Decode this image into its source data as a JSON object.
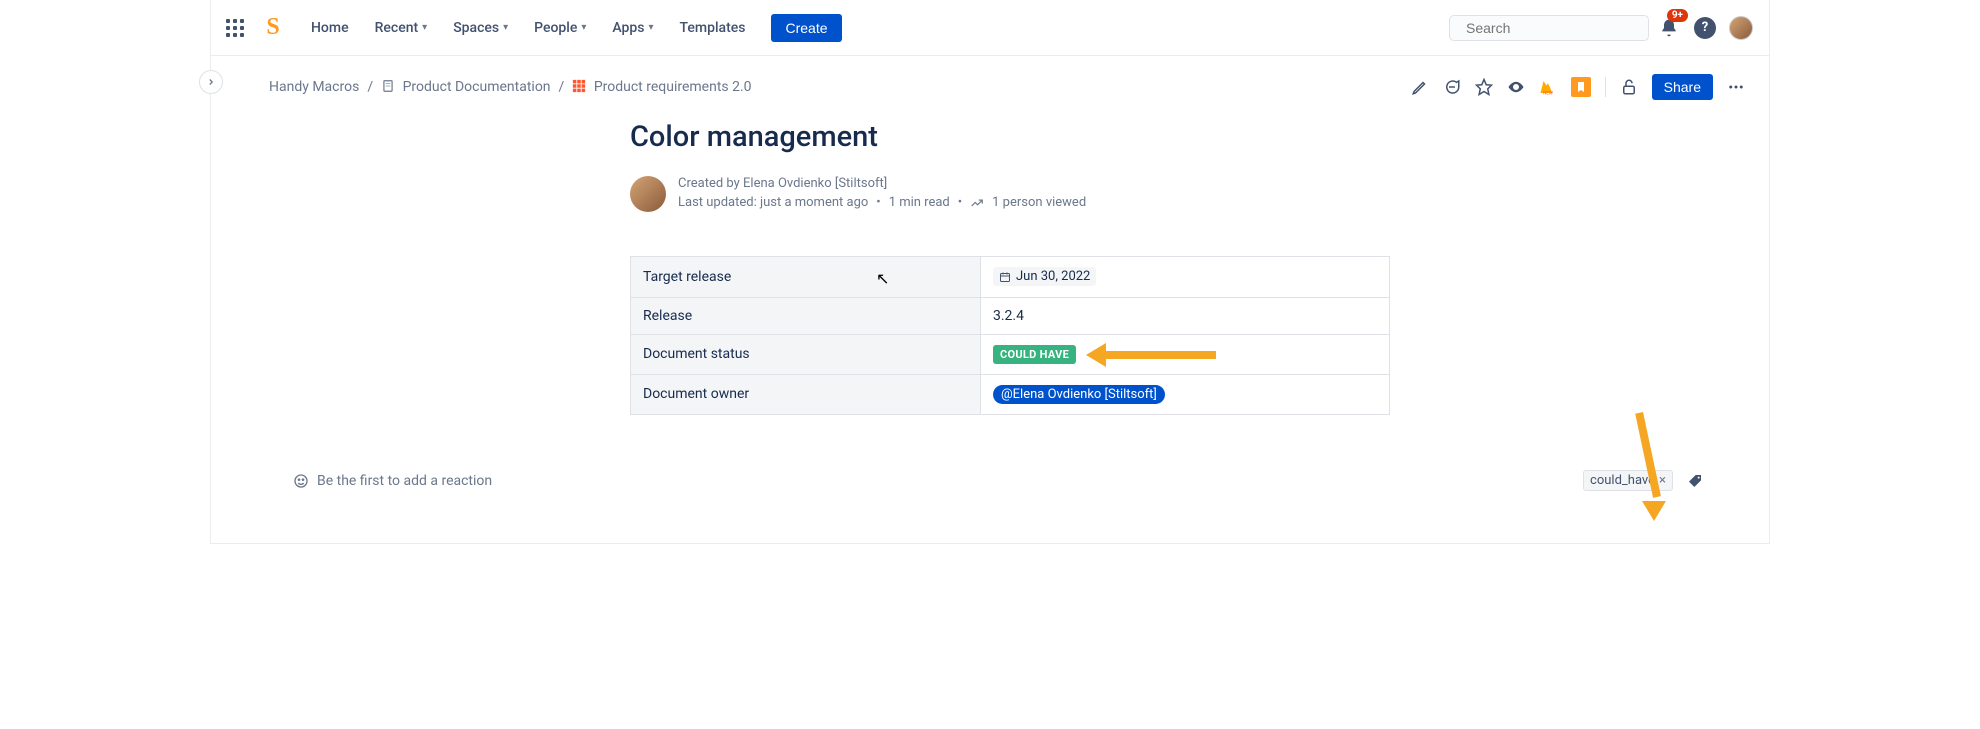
{
  "nav": {
    "home": "Home",
    "recent": "Recent",
    "spaces": "Spaces",
    "people": "People",
    "apps": "Apps",
    "templates": "Templates",
    "create": "Create"
  },
  "search": {
    "placeholder": "Search"
  },
  "notifications": {
    "badge": "9+"
  },
  "breadcrumbs": {
    "item1": "Handy Macros",
    "item2": "Product Documentation",
    "item3": "Product requirements 2.0"
  },
  "share": "Share",
  "page": {
    "title": "Color management",
    "created_by": "Created by Elena Ovdienko [Stiltsoft]",
    "updated": "Last updated: just a moment ago",
    "read_time": "1 min read",
    "views": "1 person viewed"
  },
  "table": {
    "target_release_label": "Target release",
    "target_release_value": "Jun 30, 2022",
    "release_label": "Release",
    "release_value": "3.2.4",
    "doc_status_label": "Document status",
    "doc_status_value": "COULD HAVE",
    "doc_owner_label": "Document owner",
    "doc_owner_value": "@Elena Ovdienko [Stiltsoft]"
  },
  "footer": {
    "reaction_prompt": "Be the first to add a reaction",
    "tag": "could_have"
  }
}
